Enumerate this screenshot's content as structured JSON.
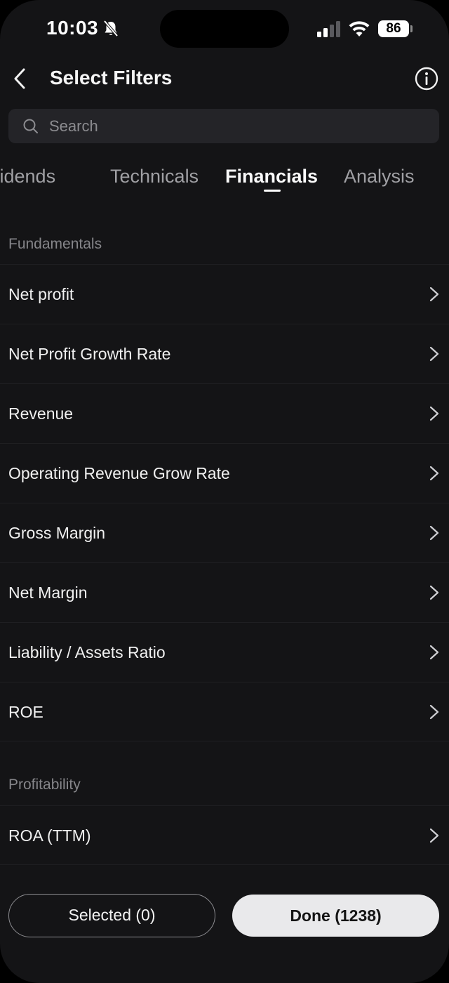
{
  "status_bar": {
    "time": "10:03",
    "battery": "86"
  },
  "header": {
    "title": "Select Filters"
  },
  "search": {
    "placeholder": "Search"
  },
  "tabs": [
    {
      "label": "Dividends",
      "visible_text": "vidends"
    },
    {
      "label": "Technicals"
    },
    {
      "label": "Financials",
      "active": true
    },
    {
      "label": "Analysis"
    }
  ],
  "sections": [
    {
      "title": "Fundamentals",
      "items": [
        {
          "label": "Net profit"
        },
        {
          "label": "Net Profit Growth Rate"
        },
        {
          "label": "Revenue"
        },
        {
          "label": "Operating Revenue Grow Rate"
        },
        {
          "label": "Gross Margin"
        },
        {
          "label": "Net Margin"
        },
        {
          "label": "Liability / Assets Ratio"
        },
        {
          "label": "ROE"
        }
      ]
    },
    {
      "title": "Profitability",
      "items": [
        {
          "label": "ROA (TTM)"
        }
      ]
    }
  ],
  "footer": {
    "selected_label": "Selected (0)",
    "done_label": "Done (1238)"
  },
  "colors": {
    "background": "#141416",
    "primary_button": "#e9e9eb",
    "text": "#f0f0f0",
    "muted_text": "#86868a"
  }
}
